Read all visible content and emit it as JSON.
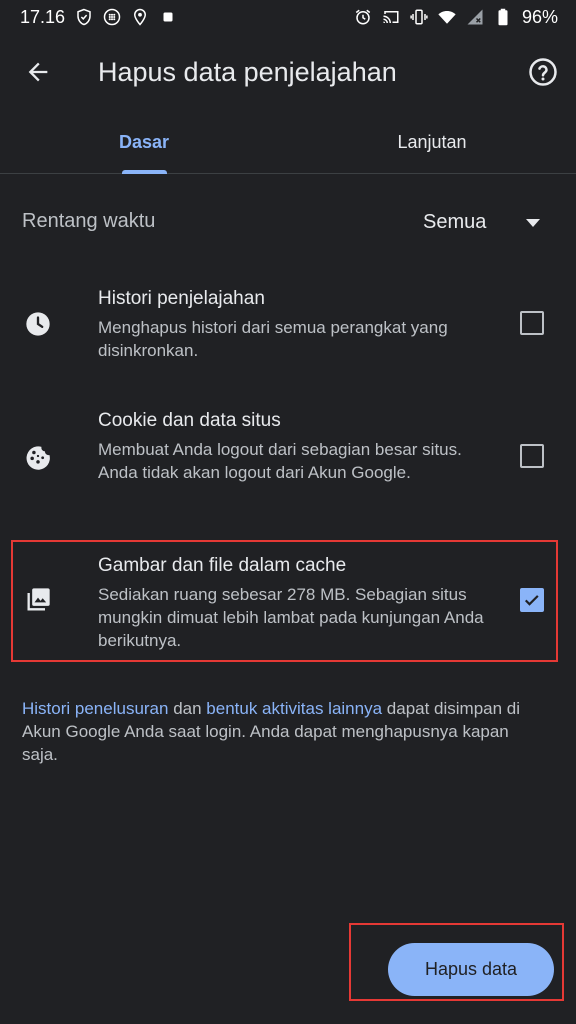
{
  "status_bar": {
    "time": "17.16",
    "battery": "96%",
    "left_icons": [
      "shield-icon",
      "grid-icon",
      "location-icon",
      "square-icon"
    ],
    "right_icons": [
      "alarm-icon",
      "cast-icon",
      "vibrate-icon",
      "wifi-icon",
      "signal-icon",
      "battery-icon"
    ]
  },
  "app_bar": {
    "title": "Hapus data penjelajahan",
    "back_icon": "arrow-back-icon",
    "help_icon": "help-icon"
  },
  "tabs": [
    {
      "label": "Dasar",
      "selected": true
    },
    {
      "label": "Lanjutan",
      "selected": false
    }
  ],
  "time_range": {
    "label": "Rentang waktu",
    "value": "Semua"
  },
  "options": [
    {
      "icon": "clock-icon",
      "title": "Histori penjelajahan",
      "description": "Menghapus histori dari semua perangkat yang disinkronkan.",
      "checked": false
    },
    {
      "icon": "cookie-icon",
      "title": "Cookie dan data situs",
      "description": "Membuat Anda logout dari sebagian besar situs. Anda tidak akan logout dari Akun Google.",
      "checked": false
    },
    {
      "icon": "image-icon",
      "title": "Gambar dan file dalam cache",
      "description": "Sediakan ruang sebesar 278 MB. Sebagian situs mungkin dimuat lebih lambat pada kunjungan Anda berikutnya.",
      "checked": true
    }
  ],
  "footnote": {
    "link1": "Histori penelusuran",
    "text1": " dan ",
    "link2": "bentuk aktivitas lainnya",
    "text2": " dapat disimpan di Akun Google Anda saat login. Anda dapat menghapusnya kapan saja."
  },
  "clear_button": {
    "label": "Hapus data"
  },
  "colors": {
    "background": "#202124",
    "accent": "#8ab4f8",
    "highlight": "#e53935"
  }
}
